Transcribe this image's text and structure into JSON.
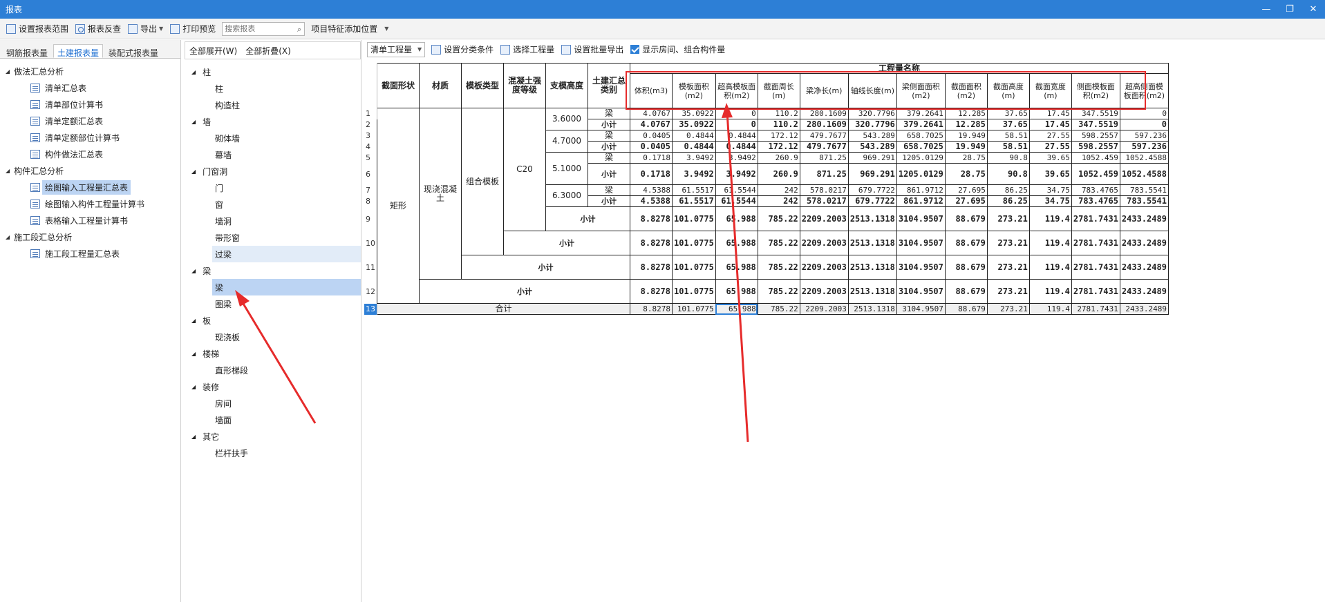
{
  "window": {
    "title": "报表",
    "min": "—",
    "restore": "❐",
    "close": "✕"
  },
  "toolbar": {
    "set_range": "设置报表范围",
    "check": "报表反查",
    "export": "导出",
    "print_preview": "打印预览",
    "search_placeholder": "搜索报表",
    "add_feature": "项目特征添加位置"
  },
  "left": {
    "tabs": [
      "钢筋报表量",
      "土建报表量",
      "装配式报表量"
    ],
    "groups": [
      {
        "label": "做法汇总分析",
        "items": [
          "清单汇总表",
          "清单部位计算书",
          "清单定额汇总表",
          "清单定额部位计算书",
          "构件做法汇总表"
        ]
      },
      {
        "label": "构件汇总分析",
        "items": [
          "绘图输入工程量汇总表",
          "绘图输入构件工程量计算书",
          "表格输入工程量计算书"
        ]
      },
      {
        "label": "施工段汇总分析",
        "items": [
          "施工段工程量汇总表"
        ]
      }
    ]
  },
  "mid": {
    "expand_all": "全部展开(W)",
    "collapse_all": "全部折叠(X)",
    "categories": [
      {
        "label": "柱",
        "items": [
          "柱",
          "构造柱"
        ]
      },
      {
        "label": "墙",
        "items": [
          "砌体墙",
          "幕墙"
        ]
      },
      {
        "label": "门窗洞",
        "items": [
          "门",
          "窗",
          "墙洞",
          "带形窗",
          "过梁"
        ]
      },
      {
        "label": "梁",
        "items": [
          "梁",
          "圈梁"
        ]
      },
      {
        "label": "板",
        "items": [
          "现浇板"
        ]
      },
      {
        "label": "楼梯",
        "items": [
          "直形梯段"
        ]
      },
      {
        "label": "装修",
        "items": [
          "房间",
          "墙面"
        ]
      },
      {
        "label": "其它",
        "items": [
          "栏杆扶手"
        ]
      }
    ]
  },
  "right_toolbar": {
    "combo": "清单工程量",
    "set_category": "设置分类条件",
    "select_qty": "选择工程量",
    "batch_export": "设置批量导出",
    "show_room": "显示房间、组合构件量"
  },
  "report": {
    "headers": {
      "section": "截面形状",
      "material": "材质",
      "formwork": "模板类型",
      "concrete": "混凝土强度等级",
      "height": "支模高度",
      "category": "土建汇总类别",
      "qty_name": "工程量名称",
      "columns": [
        "体积(m3)",
        "模板面积(m2)",
        "超高模板面积(m2)",
        "截面周长(m)",
        "梁净长(m)",
        "轴线长度(m)",
        "梁侧面面积(m2)",
        "截面面积(m2)",
        "截面高度(m)",
        "截面宽度(m)",
        "侧面模板面积(m2)",
        "超高侧面模板面积(m2)"
      ]
    },
    "group": {
      "section": "矩形",
      "material": "现浇混凝土",
      "formwork": "组合模板",
      "concrete": "C20"
    },
    "beam_label": "梁",
    "subtotal_label": "小计",
    "total_label": "合计",
    "heights": [
      "3.6000",
      "4.7000",
      "5.1000",
      "6.3000"
    ],
    "rows": [
      [
        "4.0767",
        "35.0922",
        "0",
        "110.2",
        "280.1609",
        "320.7796",
        "379.2641",
        "12.285",
        "37.65",
        "17.45",
        "347.5519",
        "0"
      ],
      [
        "4.0767",
        "35.0922",
        "0",
        "110.2",
        "280.1609",
        "320.7796",
        "379.2641",
        "12.285",
        "37.65",
        "17.45",
        "347.5519",
        "0"
      ],
      [
        "0.0405",
        "0.4844",
        "0.4844",
        "172.12",
        "479.7677",
        "543.289",
        "658.7025",
        "19.949",
        "58.51",
        "27.55",
        "598.2557",
        "597.236"
      ],
      [
        "0.0405",
        "0.4844",
        "0.4844",
        "172.12",
        "479.7677",
        "543.289",
        "658.7025",
        "19.949",
        "58.51",
        "27.55",
        "598.2557",
        "597.236"
      ],
      [
        "0.1718",
        "3.9492",
        "3.9492",
        "260.9",
        "871.25",
        "969.291",
        "1205.0129",
        "28.75",
        "90.8",
        "39.65",
        "1052.459",
        "1052.4588"
      ],
      [
        "0.1718",
        "3.9492",
        "3.9492",
        "260.9",
        "871.25",
        "969.291",
        "1205.0129",
        "28.75",
        "90.8",
        "39.65",
        "1052.459",
        "1052.4588"
      ],
      [
        "4.5388",
        "61.5517",
        "61.5544",
        "242",
        "578.0217",
        "679.7722",
        "861.9712",
        "27.695",
        "86.25",
        "34.75",
        "783.4765",
        "783.5541"
      ],
      [
        "4.5388",
        "61.5517",
        "61.5544",
        "242",
        "578.0217",
        "679.7722",
        "861.9712",
        "27.695",
        "86.25",
        "34.75",
        "783.4765",
        "783.5541"
      ],
      [
        "8.8278",
        "101.0775",
        "65.988",
        "785.22",
        "2209.2003",
        "2513.1318",
        "3104.9507",
        "88.679",
        "273.21",
        "119.4",
        "2781.7431",
        "2433.2489"
      ],
      [
        "8.8278",
        "101.0775",
        "65.988",
        "785.22",
        "2209.2003",
        "2513.1318",
        "3104.9507",
        "88.679",
        "273.21",
        "119.4",
        "2781.7431",
        "2433.2489"
      ],
      [
        "8.8278",
        "101.0775",
        "65.988",
        "785.22",
        "2209.2003",
        "2513.1318",
        "3104.9507",
        "88.679",
        "273.21",
        "119.4",
        "2781.7431",
        "2433.2489"
      ],
      [
        "8.8278",
        "101.0775",
        "65.988",
        "785.22",
        "2209.2003",
        "2513.1318",
        "3104.9507",
        "88.679",
        "273.21",
        "119.4",
        "2781.7431",
        "2433.2489"
      ],
      [
        "8.8278",
        "101.0775",
        "65.988",
        "785.22",
        "2209.2003",
        "2513.1318",
        "3104.9507",
        "88.679",
        "273.21",
        "119.4",
        "2781.7431",
        "2433.2489"
      ]
    ]
  },
  "colors": {
    "accent": "#2d7fd6",
    "annotation": "#e62b2b",
    "selected": "#bcd4f3"
  }
}
